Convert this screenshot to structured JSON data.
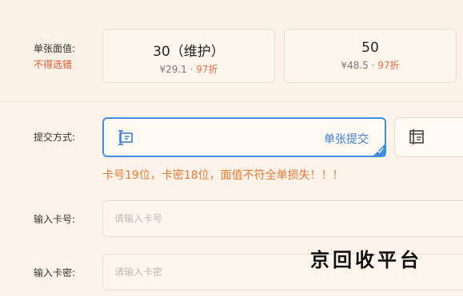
{
  "denomination": {
    "label": "单张面值:",
    "warning": "不得选错",
    "options": [
      {
        "title": "30（维护）",
        "price": "¥29.1",
        "sep": " · ",
        "discount": "97折"
      },
      {
        "title": "50",
        "price": "¥48.5",
        "sep": " · ",
        "discount": "97折"
      }
    ]
  },
  "submit_method": {
    "label": "提交方式:",
    "options": [
      {
        "label": "单张提交",
        "icon": "single-card-icon",
        "selected": true
      },
      {
        "label": "",
        "icon": "batch-card-icon",
        "selected": false
      }
    ]
  },
  "error_message": "卡号19位，卡密18位，面值不符全单损失！！！",
  "card_number": {
    "label": "输入卡号:",
    "placeholder": "请输入卡号"
  },
  "card_password": {
    "label": "输入卡密:",
    "placeholder": "请输入卡密"
  },
  "watermark": "京回收平台",
  "colors": {
    "accent": "#3a8ee6",
    "warning": "#e5552d",
    "error": "#e57a34",
    "background": "#fdf3ea"
  }
}
